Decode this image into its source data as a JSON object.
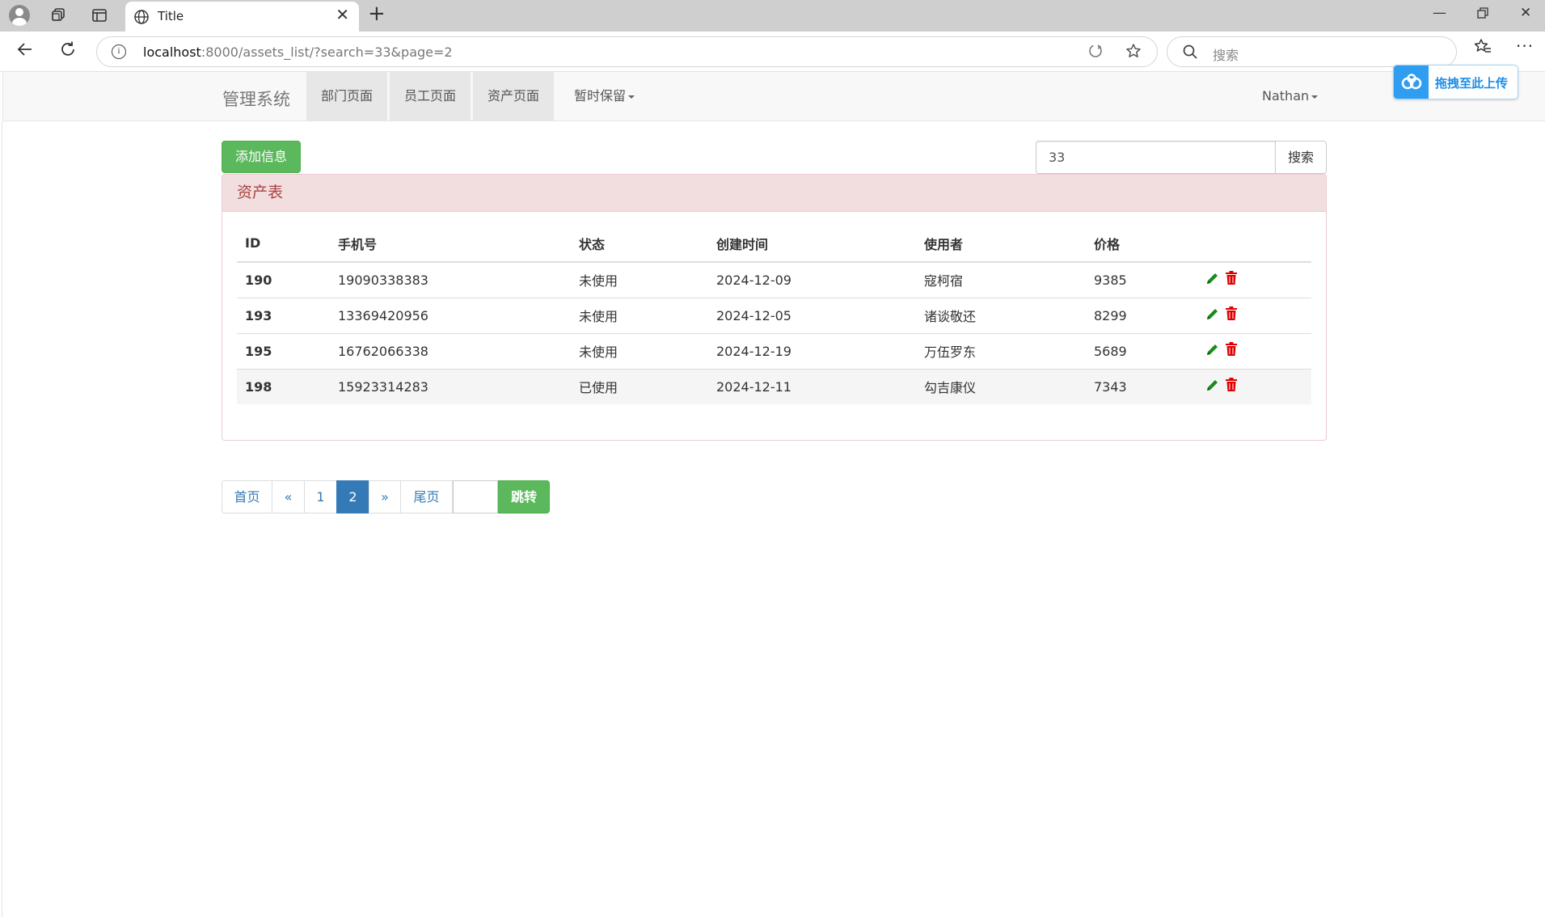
{
  "browser": {
    "tab_title": "Title",
    "url_host": "localhost",
    "url_rest": ":8000/assets_list/?search=33&page=2",
    "search_placeholder": "搜索",
    "info_glyph": "i"
  },
  "navbar": {
    "brand": "管理系统",
    "items": [
      {
        "label": "部门页面",
        "highlighted": true
      },
      {
        "label": "员工页面",
        "highlighted": true
      },
      {
        "label": "资产页面",
        "highlighted": true
      },
      {
        "label": "暂时保留",
        "highlighted": false
      }
    ],
    "user": "Nathan"
  },
  "upload_badge": {
    "label": "拖拽至此上传"
  },
  "toolbar": {
    "add_label": "添加信息",
    "search_value": "33",
    "search_button": "搜索"
  },
  "panel": {
    "title": "资产表"
  },
  "table": {
    "columns": [
      "ID",
      "手机号",
      "状态",
      "创建时间",
      "使用者",
      "价格",
      ""
    ],
    "rows": [
      {
        "id": "190",
        "phone": "19090338383",
        "status": "未使用",
        "created": "2024-12-09",
        "user": "寇柯宿",
        "price": "9385"
      },
      {
        "id": "193",
        "phone": "13369420956",
        "status": "未使用",
        "created": "2024-12-05",
        "user": "诸谈敬还",
        "price": "8299"
      },
      {
        "id": "195",
        "phone": "16762066338",
        "status": "未使用",
        "created": "2024-12-19",
        "user": "万伍罗东",
        "price": "5689"
      },
      {
        "id": "198",
        "phone": "15923314283",
        "status": "已使用",
        "created": "2024-12-11",
        "user": "勾吉康仪",
        "price": "7343"
      }
    ]
  },
  "pagination": {
    "first": "首页",
    "prev": "«",
    "pages": [
      "1",
      "2"
    ],
    "current": "2",
    "next": "»",
    "last": "尾页",
    "jump_value": "",
    "jump_button": "跳转"
  },
  "colors": {
    "success": "#5cb85c",
    "primary": "#337ab7",
    "danger_text": "#a94442",
    "danger_bg": "#f2dede",
    "unused": "#e00000",
    "used": "#008a00"
  }
}
